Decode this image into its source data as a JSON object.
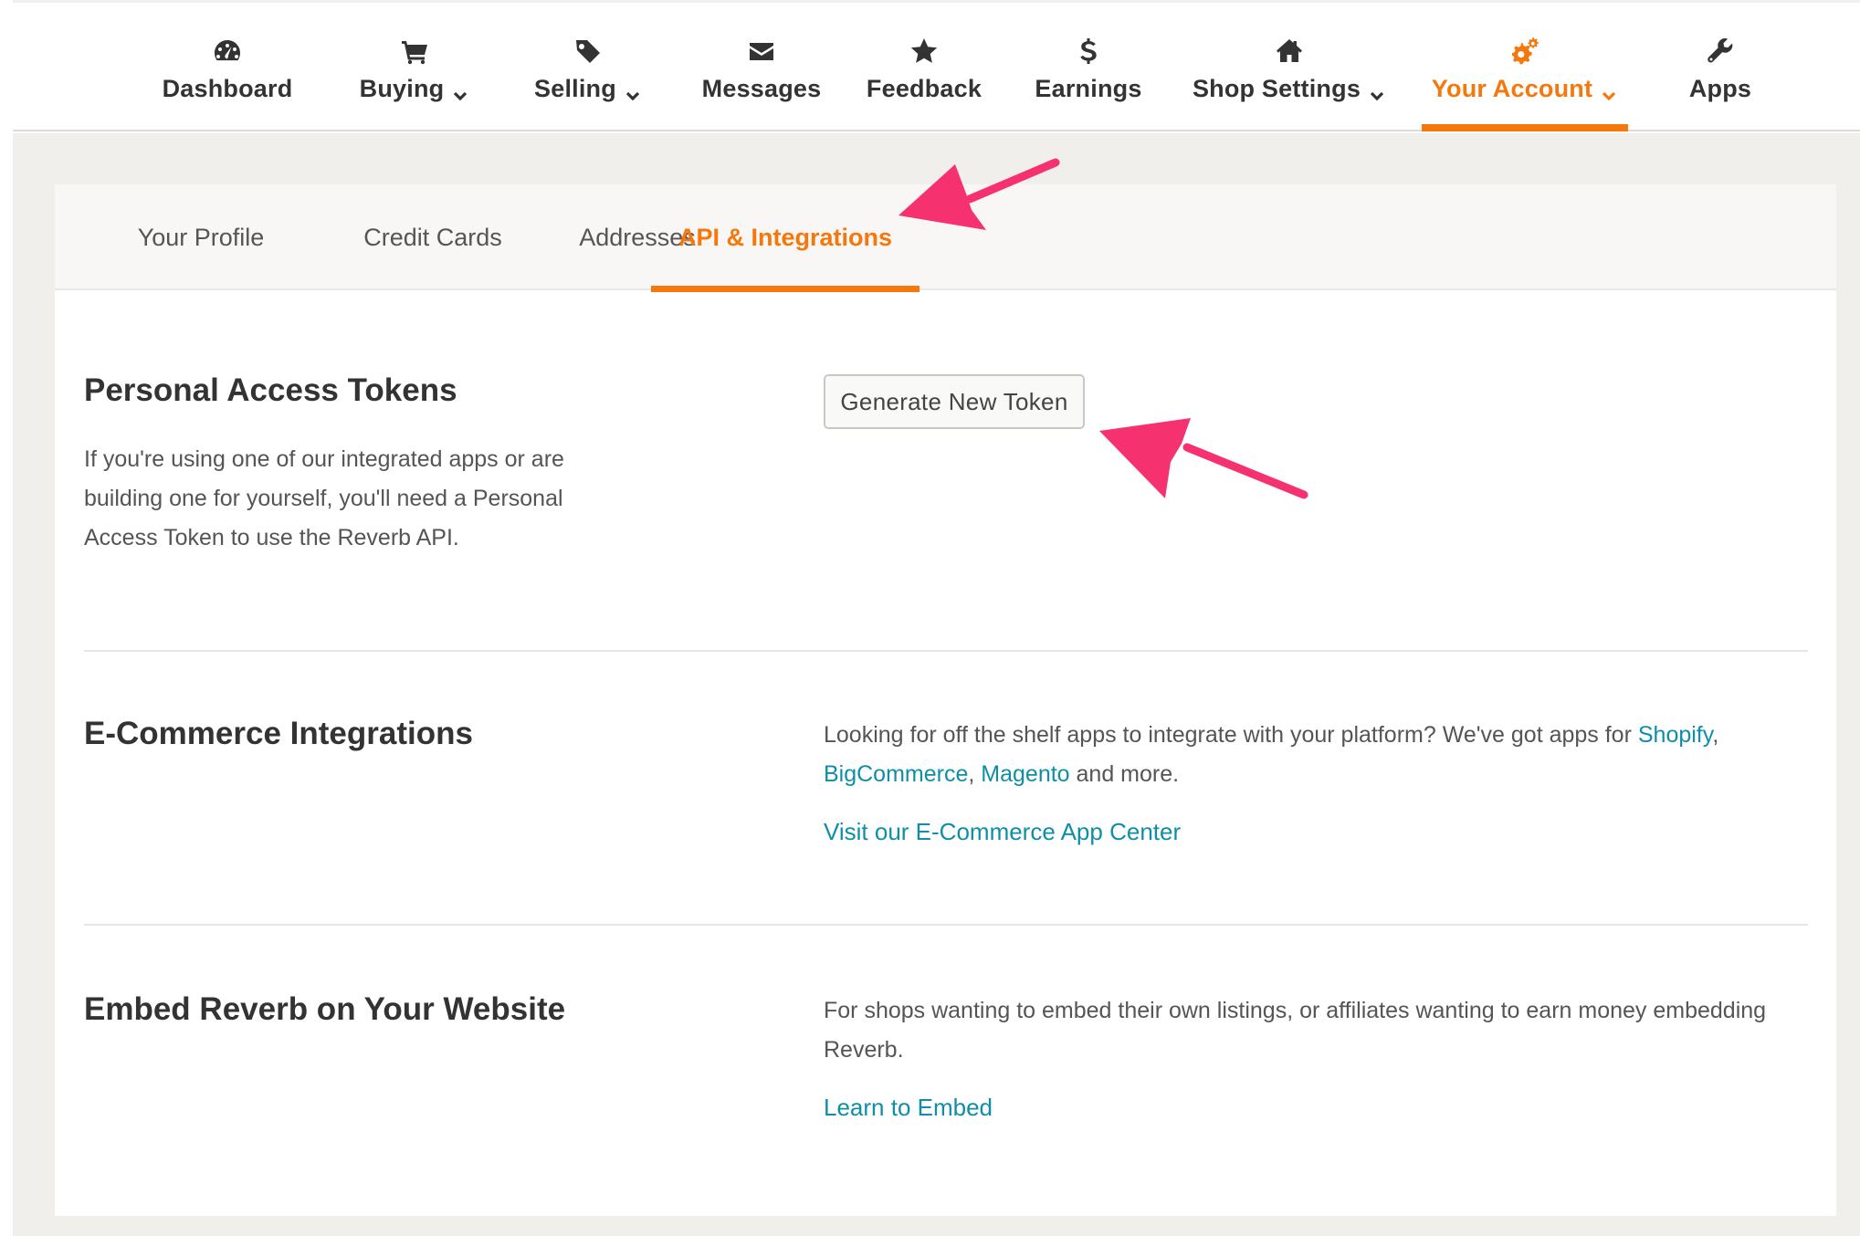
{
  "colors": {
    "accent": "#f4780b",
    "link": "#0f8ea8",
    "text": "#333333",
    "muted_text": "#555555",
    "page_background": "#f0efeb",
    "annotation_arrow": "#f5316f"
  },
  "topnav": {
    "items": [
      {
        "label": "Dashboard",
        "icon": "dashboard-icon",
        "dropdown": false
      },
      {
        "label": "Buying",
        "icon": "cart-icon",
        "dropdown": true
      },
      {
        "label": "Selling",
        "icon": "tag-icon",
        "dropdown": true
      },
      {
        "label": "Messages",
        "icon": "envelope-icon",
        "dropdown": false
      },
      {
        "label": "Feedback",
        "icon": "star-icon",
        "dropdown": false
      },
      {
        "label": "Earnings",
        "icon": "dollar-icon",
        "dropdown": false
      },
      {
        "label": "Shop Settings",
        "icon": "home-icon",
        "dropdown": true
      },
      {
        "label": "Your Account",
        "icon": "gears-icon",
        "dropdown": true,
        "active": true
      },
      {
        "label": "Apps",
        "icon": "wrench-icon",
        "dropdown": false
      }
    ]
  },
  "subtabs": {
    "items": [
      {
        "label": "Your Profile"
      },
      {
        "label": "Credit Cards"
      },
      {
        "label": "Addresses"
      },
      {
        "label": "API & Integrations",
        "active": true
      }
    ]
  },
  "sections": {
    "tokens": {
      "title": "Personal Access Tokens",
      "description": "If you're using one of our integrated apps or are building one for yourself, you'll need a Personal Access Token to use the Reverb API.",
      "button_label": "Generate New Token"
    },
    "ecommerce": {
      "title": "E-Commerce Integrations",
      "text_before": "Looking for off the shelf apps to integrate with your platform? We've got apps for ",
      "links": [
        "Shopify",
        "BigCommerce",
        "Magento"
      ],
      "separator": ", ",
      "text_after": " and more.",
      "app_center_link": "Visit our E-Commerce App Center"
    },
    "embed": {
      "title": "Embed Reverb on Your Website",
      "text": "For shops wanting to embed their own listings, or affiliates wanting to earn money embedding Reverb.",
      "link": "Learn to Embed"
    }
  }
}
